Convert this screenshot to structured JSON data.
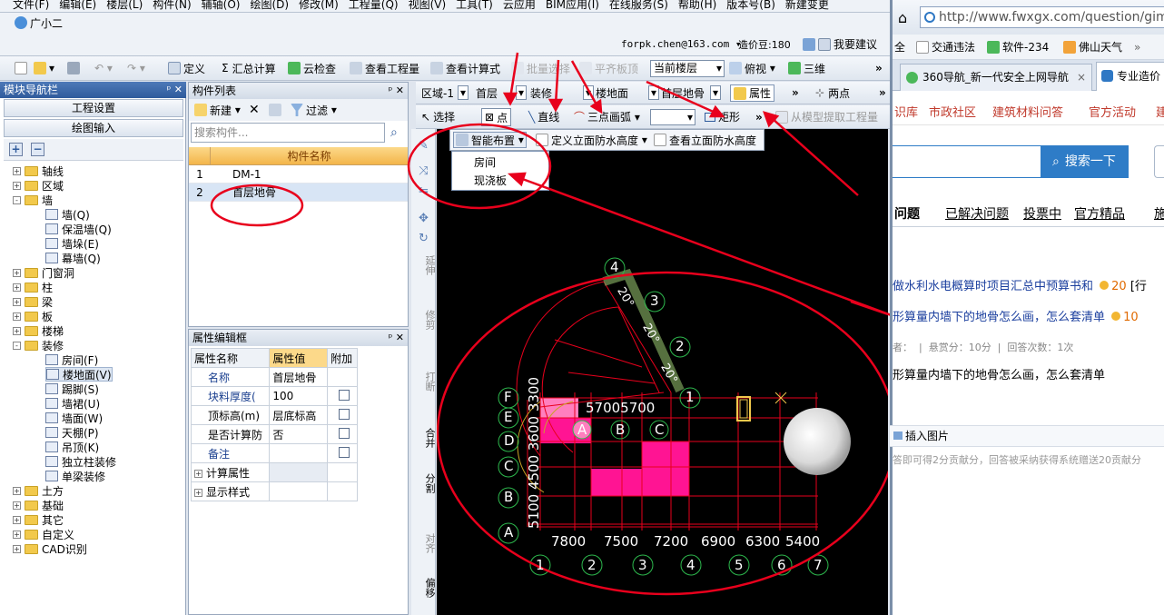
{
  "app": {
    "menu": [
      "文件(F)",
      "编辑(E)",
      "楼层(L)",
      "构件(N)",
      "辅轴(O)",
      "绘图(D)",
      "修改(M)",
      "工程量(Q)",
      "视图(V)",
      "工具(T)",
      "云应用",
      "BIM应用(I)",
      "在线服务(S)",
      "帮助(H)",
      "版本号(B)",
      "新建变更"
    ],
    "assistant": "广小二",
    "account": "forpk.chen@163.com",
    "price_beans": "造价豆:180",
    "suggest": "我要建议",
    "toolbar": {
      "define": "定义",
      "sum": "汇总计算",
      "cloud_check": "云检查",
      "view_quantity": "查看工程量",
      "view_formula": "查看计算式",
      "batch_select": "批量选择",
      "flat_slab": "平齐板顶",
      "floor_select": "当前楼层",
      "top_view": "俯视",
      "three_d": "三维"
    },
    "nav_panel": {
      "title": "模块导航栏",
      "project_settings": "工程设置",
      "drawing_input": "绘图输入",
      "tree": [
        {
          "label": "轴线",
          "type": "folder",
          "exp": "+"
        },
        {
          "label": "区域",
          "type": "folder",
          "exp": "+"
        },
        {
          "label": "墙",
          "type": "folder",
          "exp": "-"
        },
        {
          "label": "墙(Q)",
          "type": "leaf"
        },
        {
          "label": "保温墙(Q)",
          "type": "leaf"
        },
        {
          "label": "墙垛(E)",
          "type": "leaf"
        },
        {
          "label": "幕墙(Q)",
          "type": "leaf"
        },
        {
          "label": "门窗洞",
          "type": "folder",
          "exp": "+"
        },
        {
          "label": "柱",
          "type": "folder",
          "exp": "+"
        },
        {
          "label": "梁",
          "type": "folder",
          "exp": "+"
        },
        {
          "label": "板",
          "type": "folder",
          "exp": "+"
        },
        {
          "label": "楼梯",
          "type": "folder",
          "exp": "+"
        },
        {
          "label": "装修",
          "type": "folder",
          "exp": "-"
        },
        {
          "label": "房间(F)",
          "type": "leaf"
        },
        {
          "label": "楼地面(V)",
          "type": "leaf"
        },
        {
          "label": "踢脚(S)",
          "type": "leaf"
        },
        {
          "label": "墙裙(U)",
          "type": "leaf"
        },
        {
          "label": "墙面(W)",
          "type": "leaf"
        },
        {
          "label": "天棚(P)",
          "type": "leaf"
        },
        {
          "label": "吊顶(K)",
          "type": "leaf"
        },
        {
          "label": "独立柱装修",
          "type": "leaf"
        },
        {
          "label": "单梁装修",
          "type": "leaf"
        },
        {
          "label": "土方",
          "type": "folder",
          "exp": "+"
        },
        {
          "label": "基础",
          "type": "folder",
          "exp": "+"
        },
        {
          "label": "其它",
          "type": "folder",
          "exp": "+"
        },
        {
          "label": "自定义",
          "type": "folder",
          "exp": "+"
        },
        {
          "label": "CAD识别",
          "type": "folder",
          "exp": "+"
        }
      ]
    },
    "component_list": {
      "title": "构件列表",
      "new": "新建",
      "filter": "过滤",
      "search_placeholder": "搜索构件...",
      "col_header": "构件名称",
      "rows": [
        {
          "num": "1",
          "name": "DM-1"
        },
        {
          "num": "2",
          "name": "首层地骨"
        }
      ]
    },
    "property_panel": {
      "title": "属性编辑框",
      "headers": [
        "属性名称",
        "属性值",
        "附加"
      ],
      "rows": [
        {
          "name": "名称",
          "value": "首层地骨",
          "check": false
        },
        {
          "name": "块料厚度(",
          "value": "100",
          "check": true
        },
        {
          "name": "顶标高(m)",
          "value": "层底标高",
          "check": true
        },
        {
          "name": "是否计算防",
          "value": "否",
          "check": true
        },
        {
          "name": "备注",
          "value": "",
          "check": true
        }
      ],
      "groups": [
        "计算属性",
        "显示样式"
      ]
    },
    "draw_toolbar": {
      "region": "区域-1",
      "floor": "首层",
      "deco": "装修",
      "floor_type": "楼地面",
      "item": "首层地骨",
      "attributes": "属性",
      "two_point": "两点",
      "select": "选择",
      "point": "点",
      "line": "直线",
      "arc": "三点画弧",
      "rect": "矩形",
      "extract": "从模型提取工程量",
      "smart_layout": "智能布置",
      "define_height": "定义立面防水高度",
      "view_height": "查看立面防水高度",
      "dropdown": [
        "房间",
        "现浇板"
      ]
    },
    "vertical_tools": [
      "延伸",
      "修剪",
      "打断",
      "合并",
      "分割",
      "对齐",
      "偏移"
    ],
    "cad": {
      "top_dims": "57005700",
      "left_dims": "5100 4500 3600 3300",
      "bottom_dims": [
        "7800",
        "7500",
        "7200",
        "6900",
        "6300",
        "5400"
      ],
      "bottom_axes": [
        "1",
        "2",
        "3",
        "4",
        "5",
        "6",
        "7"
      ],
      "left_axes": [
        "F",
        "E",
        "D",
        "C",
        "B",
        "A"
      ],
      "arc_axes": [
        "4",
        "3",
        "2",
        "1"
      ],
      "arc_angles": [
        "20°",
        "20°",
        "20°"
      ],
      "inner_axes": [
        "A",
        "B",
        "C"
      ]
    }
  },
  "browser": {
    "url": "http://www.fwxgx.com/question/giml/",
    "bookmarks": [
      "全",
      "交通违法",
      "软件-234",
      "佛山天气"
    ],
    "tabs": [
      "360导航_新一代安全上网导航",
      "专业造价"
    ],
    "nav_links": [
      "识库",
      "市政社区",
      "建筑材料问答",
      "官方活动",
      "建筑"
    ],
    "search_button": "搜索一下",
    "sub_tabs": [
      "问题",
      "已解决问题",
      "投票中",
      "官方精品",
      "施工"
    ],
    "q1": "做水利水电概算时项目汇总中预算书和",
    "q1_score": "20",
    "q1_tag": "[行",
    "q2": "形算量内墙下的地骨怎么画，怎么套清单",
    "q2_score": "10",
    "meta": "者：  |  悬赏分：10分  |  回答次数：1次",
    "question_text": "形算量内墙下的地骨怎么画，怎么套清单",
    "insert_image": "插入图片",
    "reward_note": "答即可得2分贡献分，回答被采纳获得系统赠送20贡献分"
  }
}
